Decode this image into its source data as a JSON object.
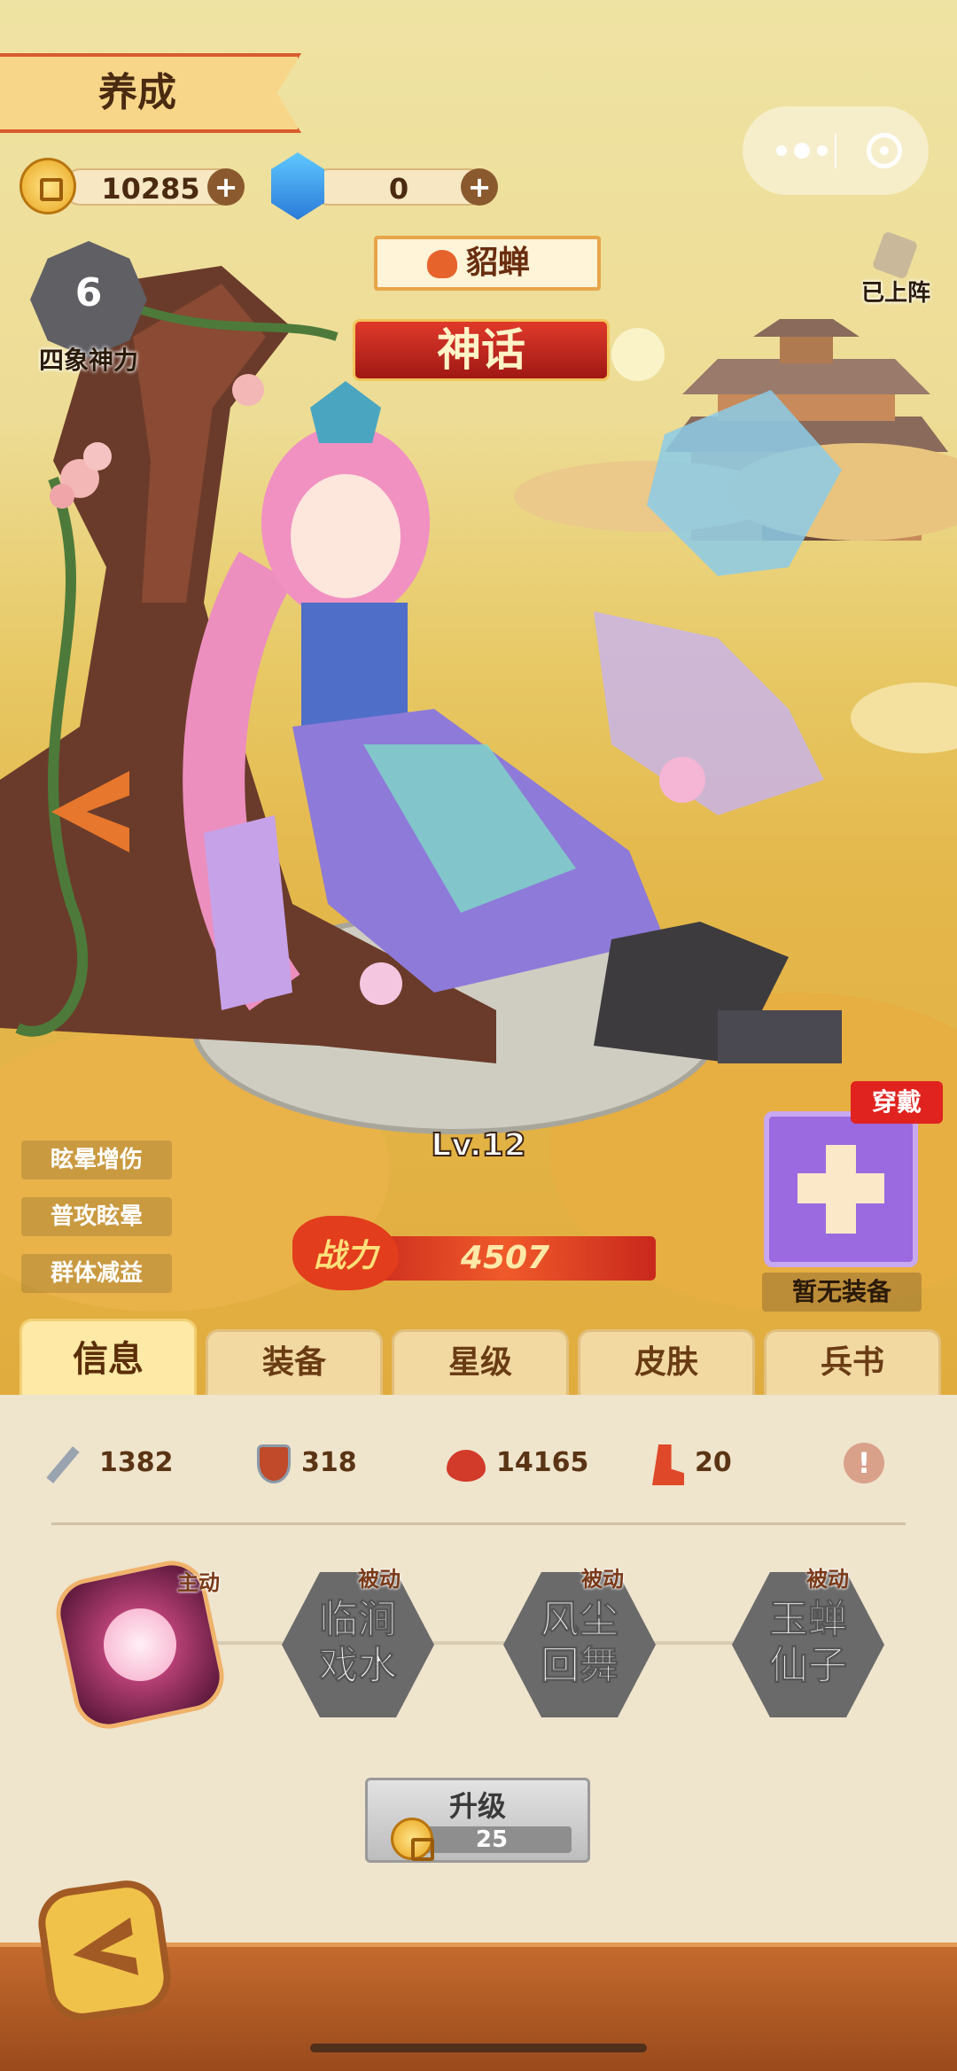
{
  "header": {
    "title": "养成"
  },
  "resources": {
    "gold": "10285",
    "gems": "0"
  },
  "mini_program": {
    "more_icon": "more-dots-icon",
    "close_icon": "target-circle-icon"
  },
  "power_badge": {
    "level": "6",
    "label": "四象神力"
  },
  "deploy_status": "已上阵",
  "hero": {
    "name": "貂蝉",
    "rarity": "神话",
    "level": "Lv.12",
    "power_label": "战力",
    "power": "4507"
  },
  "buffs": [
    "眩晕增伤",
    "普攻眩晕",
    "群体减益"
  ],
  "equip": {
    "tag": "穿戴",
    "empty_label": "暂无装备"
  },
  "tabs": [
    "信息",
    "装备",
    "星级",
    "皮肤",
    "兵书"
  ],
  "stats": [
    {
      "icon": "sword-icon",
      "value": "1382"
    },
    {
      "icon": "shield-icon",
      "value": "318"
    },
    {
      "icon": "heart-icon",
      "value": "14165"
    },
    {
      "icon": "boot-icon",
      "value": "20"
    },
    {
      "icon": "info-icon",
      "value": ""
    }
  ],
  "skills": [
    {
      "tag": "主动",
      "name": "",
      "icon": "cherry-blossom-icon"
    },
    {
      "tag": "被动",
      "name_line1": "临涧",
      "name_line2": "戏水"
    },
    {
      "tag": "被动",
      "name_line1": "风尘",
      "name_line2": "回舞"
    },
    {
      "tag": "被动",
      "name_line1": "玉蝉",
      "name_line2": "仙子"
    }
  ],
  "upgrade": {
    "label": "升级",
    "cost": "25"
  },
  "colors": {
    "accent": "#d85c2c",
    "gold": "#e9a51c",
    "purple": "#9b6ae0",
    "panel": "#efe4cc"
  }
}
